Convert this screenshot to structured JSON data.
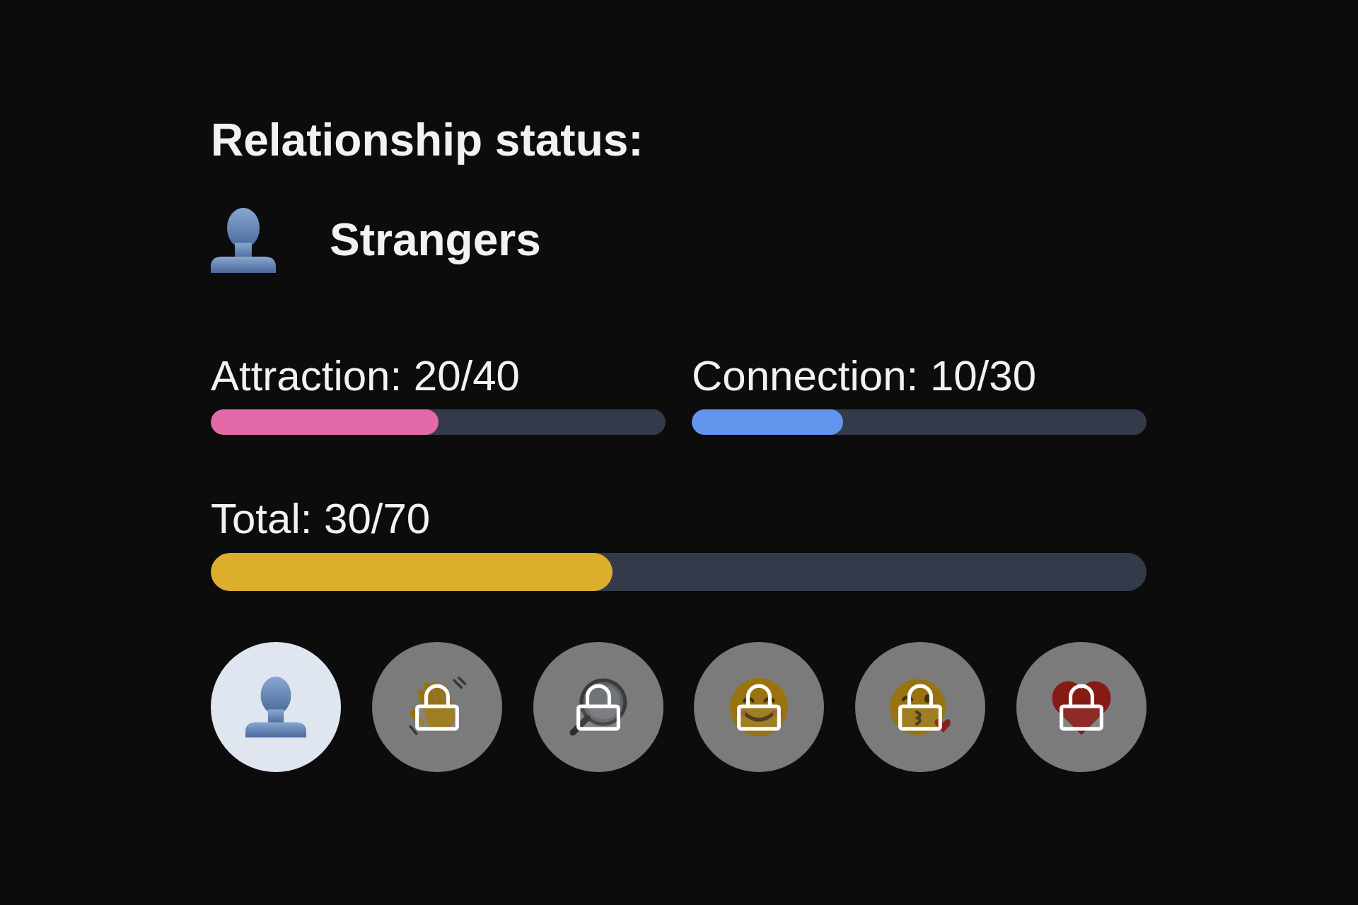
{
  "status": {
    "heading": "Relationship status:",
    "label": "Strangers"
  },
  "meters": [
    {
      "label": "Attraction: 20/40",
      "level": 0.5,
      "color": "#e36aa8"
    },
    {
      "label": "Connection: 10/30",
      "level": 0.333,
      "color": "#6394ee"
    }
  ],
  "total": {
    "label": "Total: 30/70",
    "level": 0.429
  },
  "stages": [
    {
      "kind": "person",
      "locked": false
    },
    {
      "kind": "wave",
      "locked": true
    },
    {
      "kind": "magnifier",
      "locked": true
    },
    {
      "kind": "smile",
      "locked": true
    },
    {
      "kind": "kiss",
      "locked": true
    },
    {
      "kind": "heart",
      "locked": true
    }
  ]
}
